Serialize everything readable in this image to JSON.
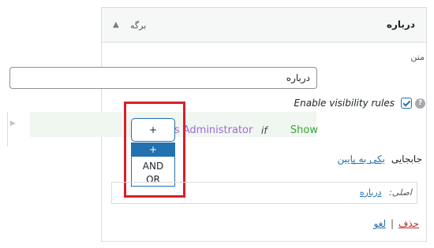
{
  "widget": {
    "title": "درباره",
    "area_label": "برگه",
    "toggle_icon": "triangle-up-icon"
  },
  "text_field": {
    "label": "متن",
    "value": "درباره"
  },
  "visibility": {
    "label": "Enable visibility rules",
    "checked": true,
    "help_icon": "?"
  },
  "rule": {
    "show": "Show",
    "if": "if",
    "condition": "Is Administrator"
  },
  "operator_select": {
    "current": "+",
    "options": [
      "+",
      "AND",
      "OR"
    ],
    "selected_index": 0
  },
  "move": {
    "label": "جابجایی",
    "link": "یکی به پایین"
  },
  "original": {
    "label": "اصلی:",
    "link": "درباره"
  },
  "actions": {
    "delete": "حذف",
    "separator": "|",
    "cancel": "لغو"
  },
  "colors": {
    "accent": "#2271b1",
    "highlight": "#d6202b",
    "show_green": "#3aa63a",
    "condition_purple": "#9b6dd6",
    "delete_red": "#b32d2e"
  }
}
